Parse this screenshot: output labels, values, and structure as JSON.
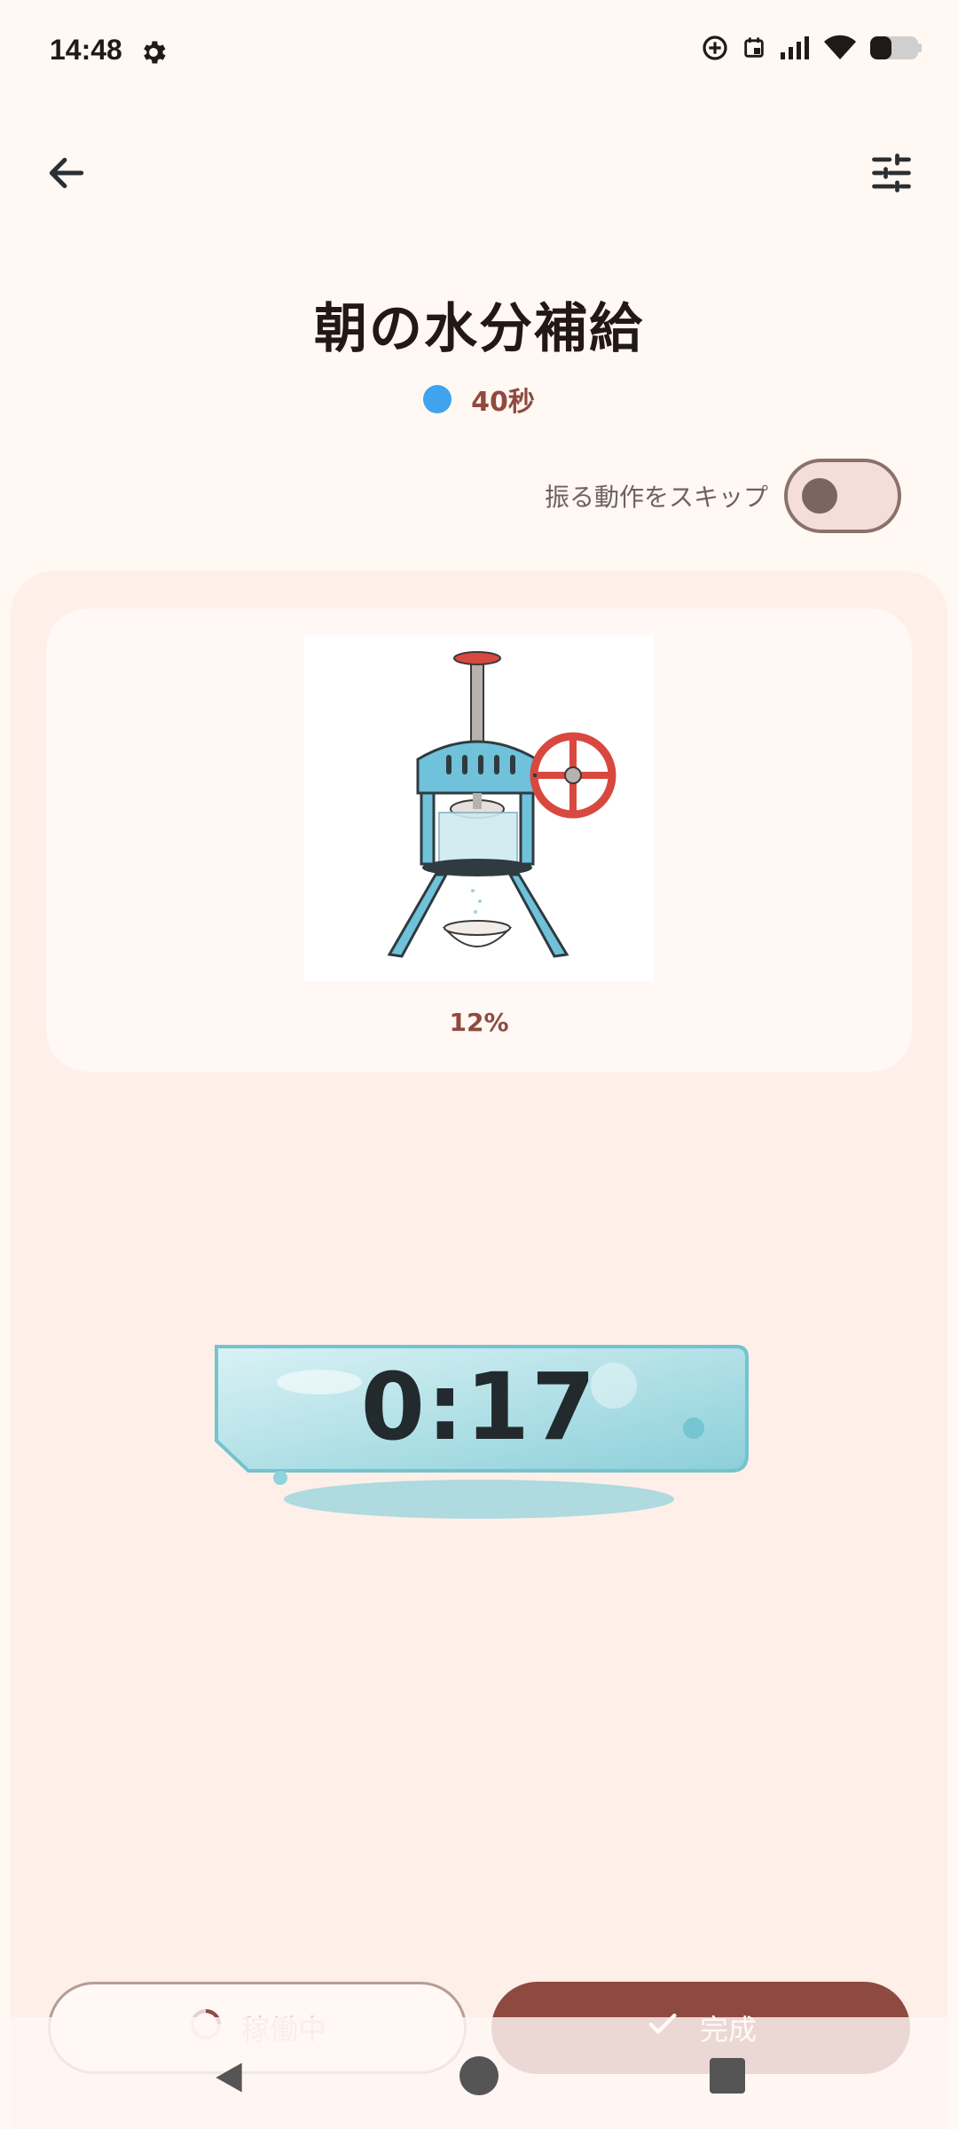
{
  "status_bar": {
    "time": "14:48",
    "icons": [
      "settings-icon",
      "location-icon",
      "calendar-icon",
      "signal-icon",
      "wifi-icon",
      "battery-icon"
    ]
  },
  "top_bar": {
    "back_icon": "arrow-left-icon",
    "settings_icon": "tune-icon"
  },
  "title": "朝の水分補給",
  "duration": {
    "dot_color": "#3FA3EE",
    "label": "40秒"
  },
  "skip": {
    "label": "振る動作をスキップ",
    "enabled": false
  },
  "machine": {
    "progress": "12%",
    "progress_value": 0.12
  },
  "timer": {
    "value": "0:17"
  },
  "buttons": {
    "running_label": "稼働中",
    "done_label": "完成"
  },
  "colors": {
    "accent": "#8F4A40",
    "panel": "#FEEFE8",
    "background": "#FFF8F3",
    "ice": "#8FD3DC"
  }
}
